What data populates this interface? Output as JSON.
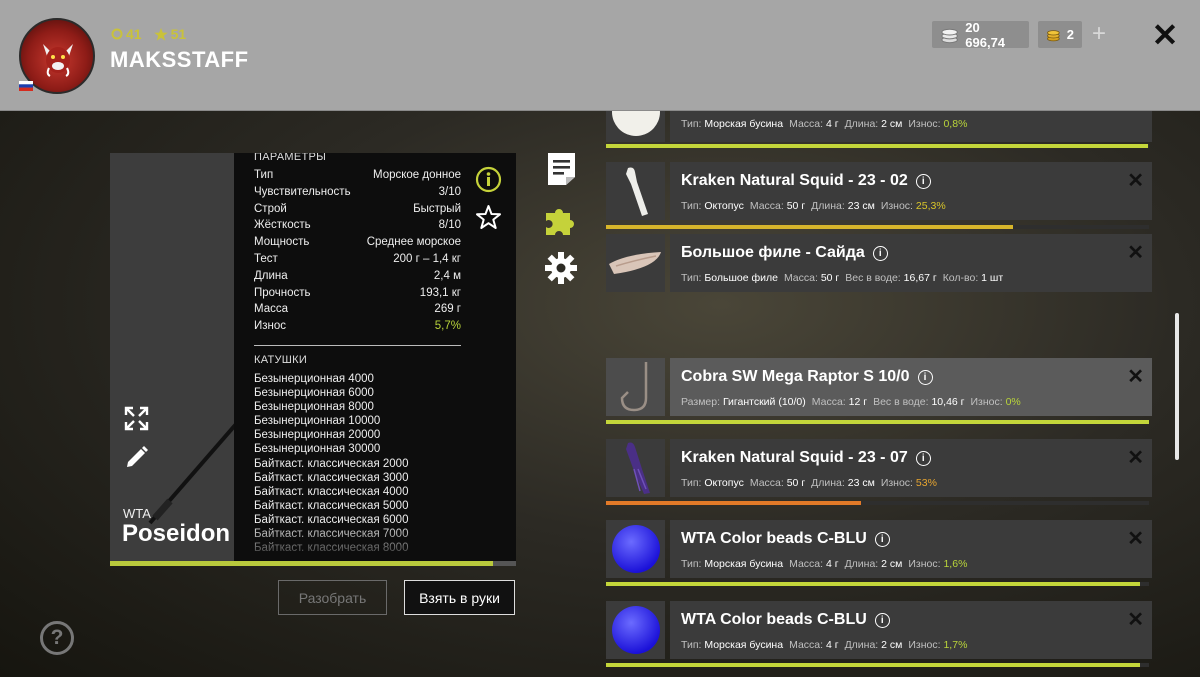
{
  "header": {
    "level_value": "41",
    "stars_value": "51",
    "username": "MAKSSTAFF",
    "silver_value": "20 696,74",
    "gold_value": "2",
    "plus_label": "+",
    "close_label": "✕"
  },
  "item": {
    "brand": "WTA",
    "model": "Poseidon",
    "params_title": "ПАРАМЕТРЫ",
    "params": [
      {
        "k": "Тип",
        "v": "Морское донное"
      },
      {
        "k": "Чувствительность",
        "v": "3/10"
      },
      {
        "k": "Строй",
        "v": "Быстрый"
      },
      {
        "k": "Жёсткость",
        "v": "8/10"
      },
      {
        "k": "Мощность",
        "v": "Среднее морское"
      },
      {
        "k": "Тест",
        "v": "200 г – 1,4 кг"
      },
      {
        "k": "Длина",
        "v": "2,4 м"
      },
      {
        "k": "Прочность",
        "v": "193,1 кг"
      },
      {
        "k": "Масса",
        "v": "269 г"
      },
      {
        "k": "Износ",
        "v": "5,7%"
      }
    ],
    "reels_title": "КАТУШКИ",
    "reels": [
      "Безынерционная 4000",
      "Безынерционная 6000",
      "Безынерционная 8000",
      "Безынерционная 10000",
      "Безынерционная 20000",
      "Безынерционная 30000",
      "Байткаст. классическая 2000",
      "Байткаст. классическая 3000",
      "Байткаст. классическая 4000",
      "Байткаст. классическая 5000",
      "Байткаст. классическая 6000",
      "Байткаст. классическая 7000",
      "Байткаст. классическая 8000"
    ],
    "condition_fraction": 0.943,
    "btn_disassemble": "Разобрать",
    "btn_take": "Взять в руки"
  },
  "help_label": "?",
  "list": [
    {
      "name": "",
      "sub": [
        [
          "Тип:",
          "Морская бусина"
        ],
        [
          "Масса:",
          "4 г"
        ],
        [
          "Длина:",
          "2 см"
        ],
        [
          "Износ:",
          "0,8%"
        ]
      ],
      "wear_color": "green",
      "bar": 0.998,
      "bar_color": "#c4d63a",
      "thumb": "white-bead"
    },
    {
      "name": "Kraken Natural Squid - 23 - 02",
      "sub": [
        [
          "Тип:",
          "Октопус"
        ],
        [
          "Масса:",
          "50 г"
        ],
        [
          "Длина:",
          "23 см"
        ],
        [
          "Износ:",
          "25,3%"
        ]
      ],
      "wear_color": "yellow",
      "bar": 0.75,
      "bar_color": "#d8b62a",
      "thumb": "white-squid"
    },
    {
      "name": "Большое филе - Сайда",
      "sub": [
        [
          "Тип:",
          "Большое филе"
        ],
        [
          "Масса:",
          "50 г"
        ],
        [
          "Вес в воде:",
          "16,67 г"
        ],
        [
          "Кол-во:",
          "1 шт"
        ]
      ],
      "wear_color": "",
      "bar": null,
      "bar_color": "",
      "thumb": "fillet"
    },
    {
      "name": "Cobra SW Mega Raptor S 10/0",
      "sub": [
        [
          "Размер:",
          "Гигантский (10/0)"
        ],
        [
          "Масса:",
          "12 г"
        ],
        [
          "Вес в воде:",
          "10,46 г"
        ],
        [
          "Износ:",
          "0%"
        ]
      ],
      "wear_color": "green",
      "bar": 1.0,
      "bar_color": "#c4d63a",
      "thumb": "hook"
    },
    {
      "name": "Kraken Natural Squid - 23 - 07",
      "sub": [
        [
          "Тип:",
          "Октопус"
        ],
        [
          "Масса:",
          "50 г"
        ],
        [
          "Длина:",
          "23 см"
        ],
        [
          "Износ:",
          "53%"
        ]
      ],
      "wear_color": "orange",
      "bar": 0.47,
      "bar_color": "#e27a28",
      "thumb": "purple-squid"
    },
    {
      "name": "WTA Color beads C-BLU",
      "sub": [
        [
          "Тип:",
          "Морская бусина"
        ],
        [
          "Масса:",
          "4 г"
        ],
        [
          "Длина:",
          "2 см"
        ],
        [
          "Износ:",
          "1,6%"
        ]
      ],
      "wear_color": "green",
      "bar": 0.984,
      "bar_color": "#c4d63a",
      "thumb": "blue-bead"
    },
    {
      "name": "WTA Color beads C-BLU",
      "sub": [
        [
          "Тип:",
          "Морская бусина"
        ],
        [
          "Масса:",
          "4 г"
        ],
        [
          "Длина:",
          "2 см"
        ],
        [
          "Износ:",
          "1,7%"
        ]
      ],
      "wear_color": "green",
      "bar": 0.983,
      "bar_color": "#c4d63a",
      "thumb": "blue-bead"
    }
  ]
}
